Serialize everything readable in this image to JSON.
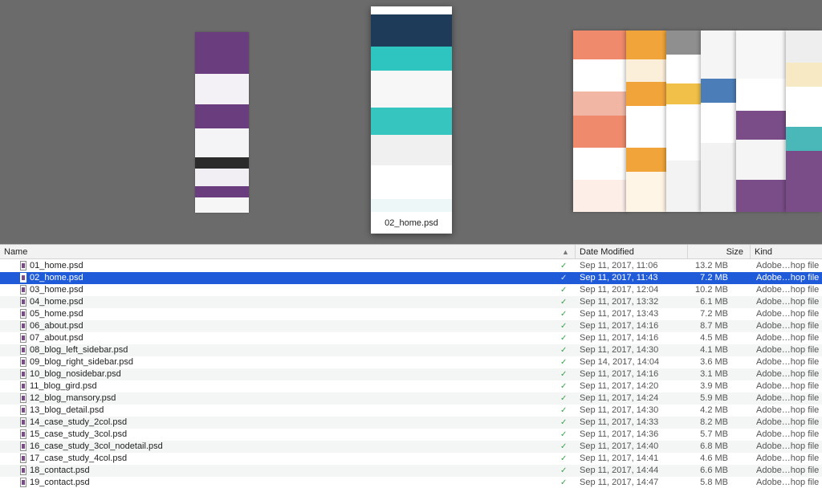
{
  "preview": {
    "selected_caption": "02_home.psd"
  },
  "columns": {
    "name": "Name",
    "date": "Date Modified",
    "size": "Size",
    "kind": "Kind"
  },
  "colors": {
    "selection": "#1f5bd8",
    "coverflow_bg": "#6b6b6b",
    "check": "#3aa34a"
  },
  "files": [
    {
      "name": "01_home.psd",
      "date": "Sep 11, 2017, 11:06",
      "size": "13.2 MB",
      "kind": "Adobe…hop file",
      "selected": false
    },
    {
      "name": "02_home.psd",
      "date": "Sep 11, 2017, 11:43",
      "size": "7.2 MB",
      "kind": "Adobe…hop file",
      "selected": true
    },
    {
      "name": "03_home.psd",
      "date": "Sep 11, 2017, 12:04",
      "size": "10.2 MB",
      "kind": "Adobe…hop file",
      "selected": false
    },
    {
      "name": "04_home.psd",
      "date": "Sep 11, 2017, 13:32",
      "size": "6.1 MB",
      "kind": "Adobe…hop file",
      "selected": false
    },
    {
      "name": "05_home.psd",
      "date": "Sep 11, 2017, 13:43",
      "size": "7.2 MB",
      "kind": "Adobe…hop file",
      "selected": false
    },
    {
      "name": "06_about.psd",
      "date": "Sep 11, 2017, 14:16",
      "size": "8.7 MB",
      "kind": "Adobe…hop file",
      "selected": false
    },
    {
      "name": "07_about.psd",
      "date": "Sep 11, 2017, 14:16",
      "size": "4.5 MB",
      "kind": "Adobe…hop file",
      "selected": false
    },
    {
      "name": "08_blog_left_sidebar.psd",
      "date": "Sep 11, 2017, 14:30",
      "size": "4.1 MB",
      "kind": "Adobe…hop file",
      "selected": false
    },
    {
      "name": "09_blog_right_sidebar.psd",
      "date": "Sep 14, 2017, 14:04",
      "size": "3.6 MB",
      "kind": "Adobe…hop file",
      "selected": false
    },
    {
      "name": "10_blog_nosidebar.psd",
      "date": "Sep 11, 2017, 14:16",
      "size": "3.1 MB",
      "kind": "Adobe…hop file",
      "selected": false
    },
    {
      "name": "11_blog_gird.psd",
      "date": "Sep 11, 2017, 14:20",
      "size": "3.9 MB",
      "kind": "Adobe…hop file",
      "selected": false
    },
    {
      "name": "12_blog_mansory.psd",
      "date": "Sep 11, 2017, 14:24",
      "size": "5.9 MB",
      "kind": "Adobe…hop file",
      "selected": false
    },
    {
      "name": "13_blog_detail.psd",
      "date": "Sep 11, 2017, 14:30",
      "size": "4.2 MB",
      "kind": "Adobe…hop file",
      "selected": false
    },
    {
      "name": "14_case_study_2col.psd",
      "date": "Sep 11, 2017, 14:33",
      "size": "8.2 MB",
      "kind": "Adobe…hop file",
      "selected": false
    },
    {
      "name": "15_case_study_3col.psd",
      "date": "Sep 11, 2017, 14:36",
      "size": "5.7 MB",
      "kind": "Adobe…hop file",
      "selected": false
    },
    {
      "name": "16_case_study_3col_nodetail.psd",
      "date": "Sep 11, 2017, 14:40",
      "size": "6.8 MB",
      "kind": "Adobe…hop file",
      "selected": false
    },
    {
      "name": "17_case_study_4col.psd",
      "date": "Sep 11, 2017, 14:41",
      "size": "4.6 MB",
      "kind": "Adobe…hop file",
      "selected": false
    },
    {
      "name": "18_contact.psd",
      "date": "Sep 11, 2017, 14:44",
      "size": "6.6 MB",
      "kind": "Adobe…hop file",
      "selected": false
    },
    {
      "name": "19_contact.psd",
      "date": "Sep 11, 2017, 14:47",
      "size": "5.8 MB",
      "kind": "Adobe…hop file",
      "selected": false
    }
  ]
}
